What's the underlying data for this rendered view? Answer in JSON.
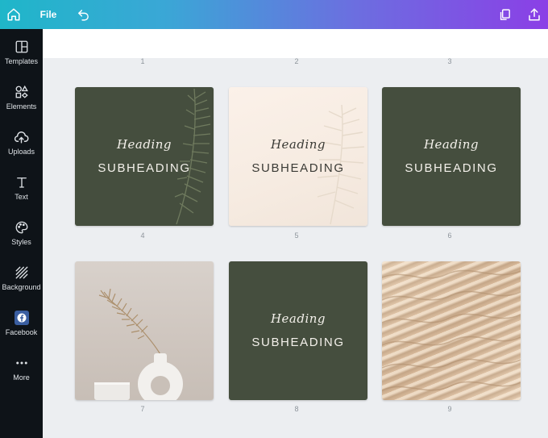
{
  "topbar": {
    "home_icon": "home-icon",
    "file_label": "File",
    "undo_icon": "undo-icon",
    "copy_icon": "duplicate-icon",
    "share_icon": "share-icon"
  },
  "sidebar": {
    "items": [
      {
        "label": "Templates",
        "icon": "templates-icon"
      },
      {
        "label": "Elements",
        "icon": "elements-icon"
      },
      {
        "label": "Uploads",
        "icon": "upload-cloud-icon"
      },
      {
        "label": "Text",
        "icon": "text-icon"
      },
      {
        "label": "Styles",
        "icon": "palette-icon"
      },
      {
        "label": "Background",
        "icon": "background-icon"
      },
      {
        "label": "Facebook",
        "icon": "facebook-icon"
      },
      {
        "label": "More",
        "icon": "more-dots-icon"
      }
    ]
  },
  "pages": {
    "top_numbers": [
      "1",
      "2",
      "3"
    ],
    "grid": [
      {
        "number": "4",
        "style": "dark",
        "heading": "Heading",
        "subheading": "SUBHEADING"
      },
      {
        "number": "5",
        "style": "cream",
        "heading": "Heading",
        "subheading": "SUBHEADING"
      },
      {
        "number": "6",
        "style": "dark",
        "heading": "Heading",
        "subheading": "SUBHEADING"
      },
      {
        "number": "7",
        "style": "photo"
      },
      {
        "number": "8",
        "style": "dark",
        "heading": "Heading",
        "subheading": "SUBHEADING"
      },
      {
        "number": "9",
        "style": "sand"
      }
    ]
  },
  "colors": {
    "sidebar_bg": "#0e1318",
    "dark_card": "#454e3e",
    "gradient_start": "#1fb6c9",
    "gradient_end": "#8b3fe6"
  }
}
